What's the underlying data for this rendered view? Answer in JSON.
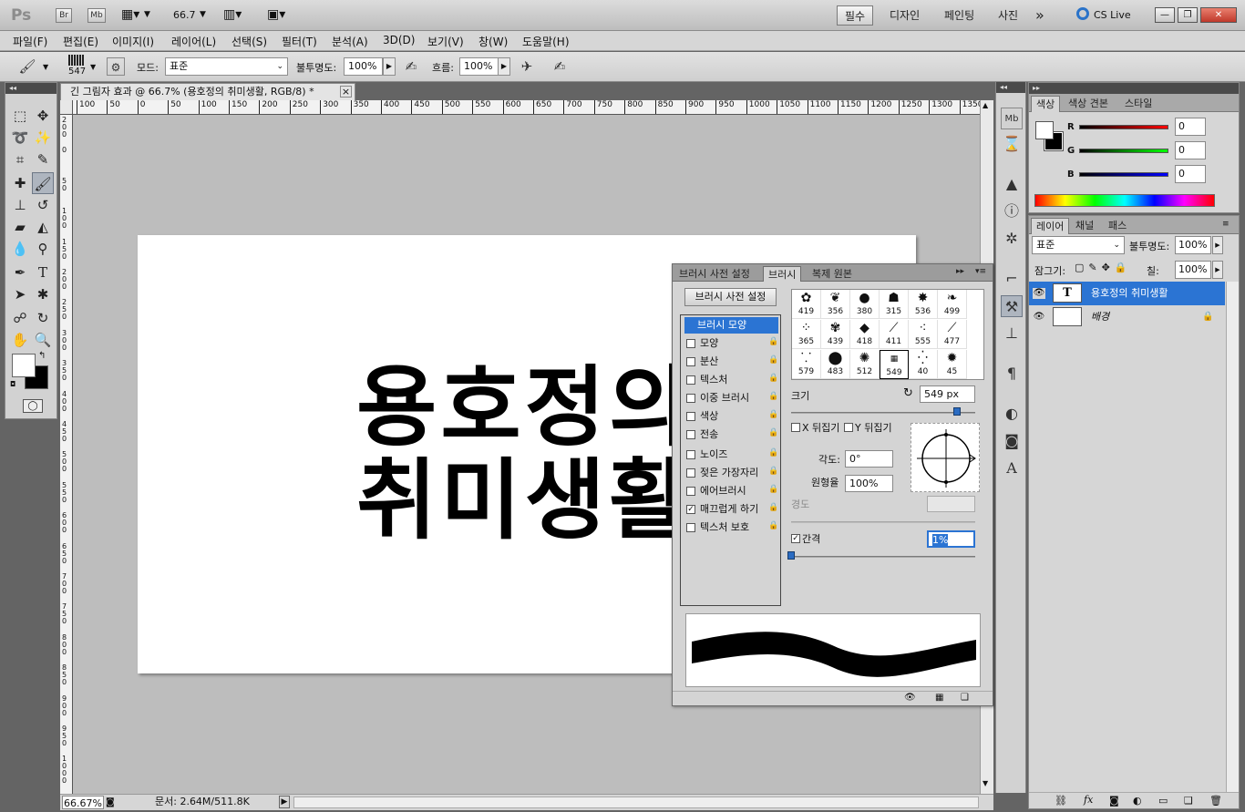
{
  "appbar": {
    "logo": "Ps",
    "br": "Br",
    "mb": "Mb",
    "zoom": "66.7",
    "workspaces": [
      "필수",
      "디자인",
      "페인팅",
      "사진"
    ],
    "more": "»",
    "cslive": "CS Live"
  },
  "menu": [
    "파일(F)",
    "편집(E)",
    "이미지(I)",
    "레이어(L)",
    "선택(S)",
    "필터(T)",
    "분석(A)",
    "3D(D)",
    "보기(V)",
    "창(W)",
    "도움말(H)"
  ],
  "options": {
    "brush_size": "547",
    "mode_label": "모드:",
    "mode_value": "표준",
    "opacity_label": "불투명도:",
    "opacity_value": "100%",
    "flow_label": "흐름:",
    "flow_value": "100%"
  },
  "document": {
    "tab_title": "긴 그림자 효과 @ 66.7% (용호정의 취미생활, RGB/8) *",
    "close": "×",
    "canvas_text": "용호정의\n취미생활",
    "ruler_h": [
      "100",
      "50",
      "0",
      "50",
      "100",
      "150",
      "200",
      "250",
      "300",
      "350",
      "400",
      "450",
      "500",
      "550",
      "600",
      "650",
      "700",
      "750",
      "800",
      "850",
      "900",
      "950",
      "1000",
      "1050",
      "1100",
      "1150",
      "1200",
      "1250",
      "1300",
      "1350"
    ],
    "ruler_v": [
      "2 0 0",
      "0",
      "5 0",
      "1 0 0",
      "1 5 0",
      "2 0 0",
      "2 5 0",
      "3 0 0",
      "3 5 0",
      "4 0 0",
      "4 5 0",
      "5 0 0",
      "5 5 0",
      "6 0 0",
      "6 5 0",
      "7 0 0",
      "7 5 0",
      "8 0 0",
      "8 5 0",
      "9 0 0",
      "9 5 0",
      "1 0 0 0"
    ]
  },
  "status": {
    "zoom": "66.67%",
    "doc": "문서: 2.64M/511.8K"
  },
  "brush_panel": {
    "tabs": [
      "브러시 사전 설정",
      "브러시",
      "복제 원본"
    ],
    "preset_button": "브러시 사전 설정",
    "items": [
      {
        "label": "브러시 모양",
        "checked": null,
        "lock": false
      },
      {
        "label": "모양",
        "checked": false,
        "lock": true
      },
      {
        "label": "분산",
        "checked": false,
        "lock": true
      },
      {
        "label": "텍스처",
        "checked": false,
        "lock": true
      },
      {
        "label": "이중 브러시",
        "checked": false,
        "lock": true
      },
      {
        "label": "색상",
        "checked": false,
        "lock": true
      },
      {
        "label": "전송",
        "checked": false,
        "lock": true
      },
      {
        "label": "노이즈",
        "checked": false,
        "lock": true
      },
      {
        "label": "젖은 가장자리",
        "checked": false,
        "lock": true
      },
      {
        "label": "에어브러시",
        "checked": false,
        "lock": true
      },
      {
        "label": "매끄럽게 하기",
        "checked": true,
        "lock": true
      },
      {
        "label": "텍스처 보호",
        "checked": false,
        "lock": true
      }
    ],
    "brushes": [
      "419",
      "356",
      "380",
      "315",
      "536",
      "499",
      "365",
      "439",
      "418",
      "411",
      "555",
      "477",
      "579",
      "483",
      "512",
      "549",
      "40",
      "45"
    ],
    "size_label": "크기",
    "size_value": "549 px",
    "flip_x": "X 뒤집기",
    "flip_y": "Y 뒤집기",
    "angle_label": "각도:",
    "angle_value": "0°",
    "roundness_label": "원형율",
    "roundness_value": "100%",
    "hardness_label": "경도",
    "spacing_label": "간격",
    "spacing_value": "1%",
    "spacing_checked": "✓"
  },
  "color_panel": {
    "tabs": [
      "색상",
      "색상 견본",
      "스타일"
    ],
    "channels": [
      {
        "label": "R",
        "value": "0",
        "color": "#ff0000"
      },
      {
        "label": "G",
        "value": "0",
        "color": "#00c000"
      },
      {
        "label": "B",
        "value": "0",
        "color": "#0000ff"
      }
    ]
  },
  "layers_panel": {
    "tabs": [
      "레이어",
      "채널",
      "패스"
    ],
    "blend_mode": "표준",
    "opacity_label": "불투명도:",
    "opacity_value": "100%",
    "lock_label": "잠그기:",
    "fill_label": "칠:",
    "fill_value": "100%",
    "layers": [
      {
        "name": "용호정의 취미생활",
        "thumb": "T",
        "selected": true
      },
      {
        "name": "배경",
        "thumb": "",
        "selected": false
      }
    ]
  }
}
